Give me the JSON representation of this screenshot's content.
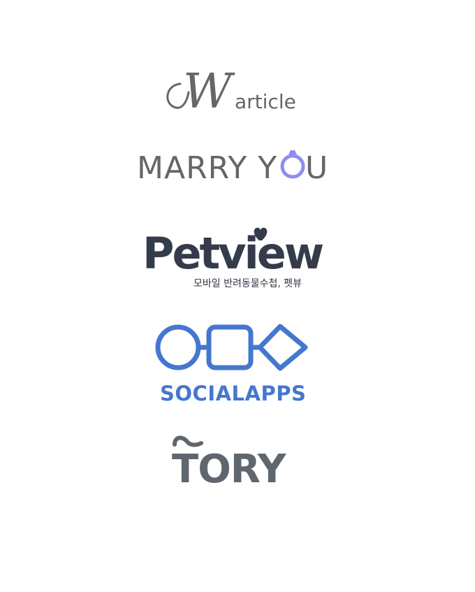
{
  "logos": [
    {
      "name": "Warticle",
      "mark_letter": "W",
      "wordmark": "article",
      "color": "#666666"
    },
    {
      "name": "MARRY YOU",
      "wordmark_part1": "MARRY Y",
      "wordmark_part2": "U",
      "color": "#666666",
      "accent_color": "#8e8df0",
      "icon": "ring-icon"
    },
    {
      "name": "Petview",
      "wordmark": "Petview",
      "caption": "모바일 반려동물수첩, 펫뷰",
      "color": "#343b4a",
      "icon": "heart-icon"
    },
    {
      "name": "SOCIALAPPS",
      "wordmark": "SOCIALAPPS",
      "color": "#4477cf",
      "icon": "circle-square-diamond-icon"
    },
    {
      "name": "TORY",
      "wordmark": "TORY",
      "color": "#5f666d"
    }
  ]
}
